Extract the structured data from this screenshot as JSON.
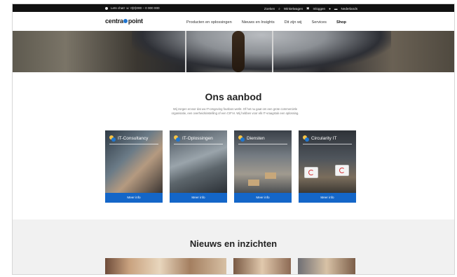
{
  "topbar": {
    "phone": "Lets chat! ☏ 0(0)000 – 0 000 000",
    "links": [
      "Zoeken",
      "Winkelwagen",
      "Inloggen",
      "Nederlands"
    ]
  },
  "nav": {
    "logo_left": "centra",
    "logo_right": "point",
    "items": [
      "Producten en oplossingen",
      "Nieuws en Insights",
      "Dit zijn wij",
      "Services",
      "Shop"
    ]
  },
  "offer": {
    "title": "Ons aanbod",
    "subtitle": "Wij zorgen ervoor dat uw IT-omgeving foutloos werkt. Of het nu gaat om een grote commerciële organisatie, een overheidsinstelling of een CIF'er. Wij hebben voor elk IT-vraagstuk een oplossing.",
    "cards": [
      {
        "title": "IT-Consultancy",
        "button": "Meer info"
      },
      {
        "title": "IT-Oplossingen",
        "button": "Meer info"
      },
      {
        "title": "Diensten",
        "button": "Meer info"
      },
      {
        "title": "Circularity IT",
        "button": "Meer info"
      }
    ]
  },
  "news": {
    "title": "Nieuws en inzichten"
  },
  "colors": {
    "accent_blue": "#1466c8",
    "logo_dot": "#1f76d0",
    "icon_yellow": "#f6c445",
    "topbar": "#111111"
  }
}
